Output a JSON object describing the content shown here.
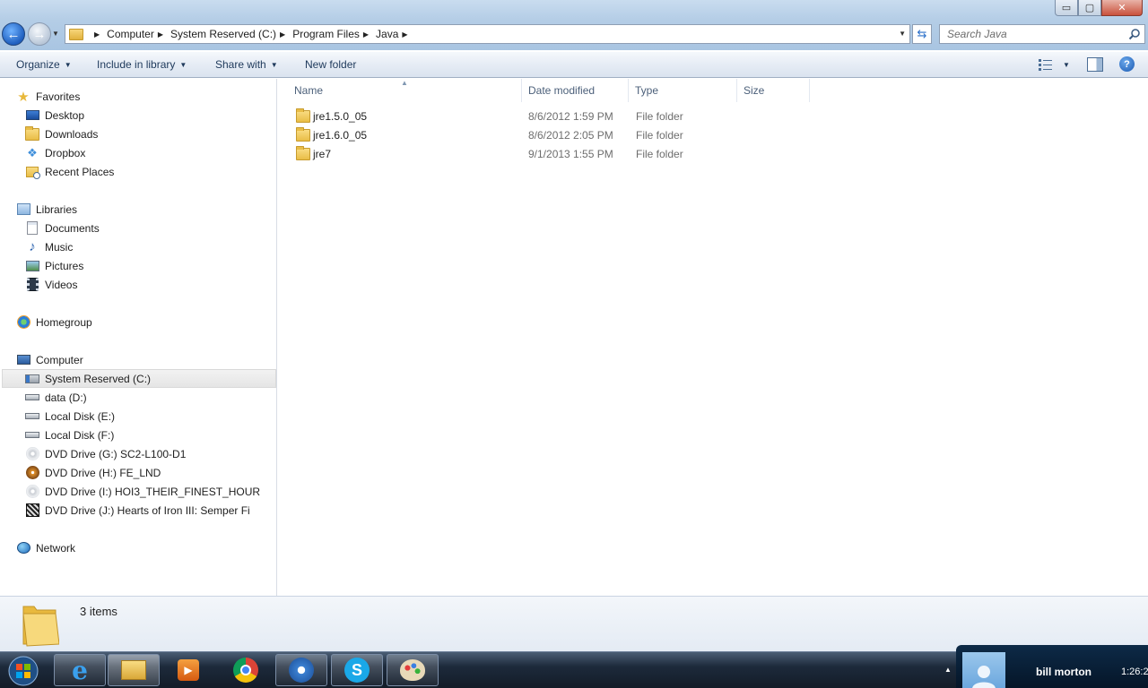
{
  "window": {
    "caption_buttons": {
      "minimize": "▭",
      "maximize": "▢",
      "close": "✕"
    }
  },
  "address_bar": {
    "crumbs": [
      "Computer",
      "System Reserved (C:)",
      "Program Files",
      "Java"
    ]
  },
  "search": {
    "placeholder": "Search Java"
  },
  "command_bar": {
    "organize": "Organize",
    "include_in_library": "Include in library",
    "share_with": "Share with",
    "new_folder": "New folder"
  },
  "nav": {
    "favorites": {
      "label": "Favorites",
      "items": [
        "Desktop",
        "Downloads",
        "Dropbox",
        "Recent Places"
      ]
    },
    "libraries": {
      "label": "Libraries",
      "items": [
        "Documents",
        "Music",
        "Pictures",
        "Videos"
      ]
    },
    "homegroup": "Homegroup",
    "computer": {
      "label": "Computer",
      "items": [
        "System Reserved (C:)",
        "data (D:)",
        "Local Disk (E:)",
        "Local Disk (F:)",
        "DVD Drive (G:) SC2-L100-D1",
        "DVD Drive (H:) FE_LND",
        "DVD Drive (I:) HOI3_THEIR_FINEST_HOUR",
        "DVD Drive (J:) Hearts of Iron III: Semper Fi"
      ],
      "selected_index": 0
    },
    "network": "Network"
  },
  "columns": {
    "name": "Name",
    "date_modified": "Date modified",
    "type": "Type",
    "size": "Size"
  },
  "files": [
    {
      "name": "jre1.5.0_05",
      "date": "8/6/2012 1:59 PM",
      "type": "File folder"
    },
    {
      "name": "jre1.6.0_05",
      "date": "8/6/2012 2:05 PM",
      "type": "File folder"
    },
    {
      "name": "jre7",
      "date": "9/1/2013 1:55 PM",
      "type": "File folder"
    }
  ],
  "details": {
    "item_count": "3 items"
  },
  "taskbar": {
    "pinned": [
      "internet-explorer-icon",
      "windows-explorer-icon",
      "media-player-icon",
      "chrome-icon",
      "app-icon",
      "skype-icon",
      "paint-icon"
    ],
    "user_name": "bill morton",
    "clock": "1:26:2"
  },
  "colors": {
    "accent": "#1e395b",
    "selection": "#e5e5e5",
    "folder": "#e9bd47"
  }
}
